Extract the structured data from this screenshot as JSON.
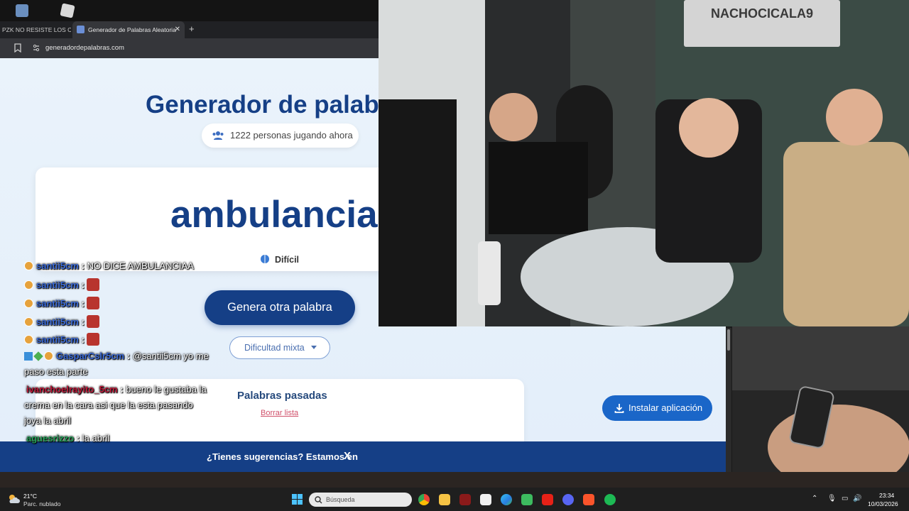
{
  "browser": {
    "tabs": [
      {
        "title": "PZK NO RESISTE LOS CH",
        "active": false
      },
      {
        "title": "Generador de Palabras Aleatoria",
        "active": true
      }
    ],
    "url": "generadordepalabras.com"
  },
  "site": {
    "title": "Generador de palab",
    "players_online": "1222 personas jugando ahora",
    "current_word": "ambulancia",
    "difficulty": "Difícil",
    "generate_button": "Genera otra palabra",
    "difficulty_select": "Dificultad mixta",
    "past_words_title": "Palabras pasadas",
    "clear_list": "Borrar lista",
    "install_button": "Instalar aplicación",
    "suggestions_bar": "¿Tienes sugerencias? Estamos en",
    "suggestions_icon": "X"
  },
  "overlay": {
    "banner_text": "NACHOCICALA9"
  },
  "chat": [
    {
      "user": "santii5cm",
      "sep": ":",
      "message": "NO DICE AMBULANCIAA",
      "user_color": "#3b6bd9"
    },
    {
      "user": "santii5cm",
      "sep": ":",
      "message": "",
      "user_color": "#3b6bd9"
    },
    {
      "user": "santii5cm",
      "sep": ":",
      "message": "",
      "user_color": "#3b6bd9"
    },
    {
      "user": "santii5cm",
      "sep": ":",
      "message": "",
      "user_color": "#3b6bd9"
    },
    {
      "user": "santii5cm",
      "sep": ":",
      "message": "",
      "user_color": "#3b6bd9"
    },
    {
      "user": "GasparCslr5cm",
      "sep": ":",
      "message": "@santii5cm yo me",
      "continuation": "paso esta parte",
      "user_color": "#3b6bd9"
    },
    {
      "user": "ivanchoelrayito_5cm",
      "sep": ":",
      "message": "bueno le gustaba la",
      "continuation": [
        "crema en la cara asi que la esta pasando",
        "joya la abril"
      ],
      "user_color": "#c01a3a"
    },
    {
      "user": "aguesrizzo",
      "sep": ":",
      "message": "la abril",
      "user_color": "#27a35a"
    }
  ],
  "taskbar": {
    "weather_temp": "21°C",
    "weather_desc": "Parc. nublado",
    "search_placeholder": "Búsqueda",
    "time": "23:34",
    "date": "10/03/2026"
  }
}
